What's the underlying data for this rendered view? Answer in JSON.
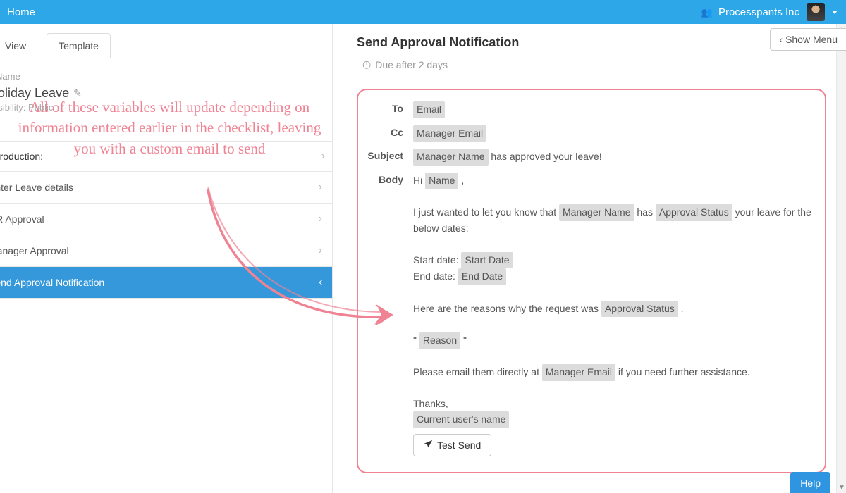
{
  "topbar": {
    "home": "Home",
    "org_name": "Processpants Inc"
  },
  "tabs": {
    "view": "View",
    "template": "Template",
    "active": "template"
  },
  "sidebar": {
    "name_label": "Name",
    "title": "Holiday Leave",
    "visibility": "Visibility: Public",
    "section_heading": "Introduction:",
    "items": [
      {
        "label": "Enter Leave details",
        "active": false
      },
      {
        "label": "HR Approval",
        "active": false
      },
      {
        "label": "Manager Approval",
        "active": false
      },
      {
        "label": "Send Approval Notification",
        "active": true
      }
    ]
  },
  "main": {
    "title": "Send Approval Notification",
    "due_text": "Due after 2 days",
    "show_menu": "Show Menu"
  },
  "email": {
    "labels": {
      "to": "To",
      "cc": "Cc",
      "subject": "Subject",
      "body": "Body"
    },
    "to_var": "Email",
    "cc_var": "Manager Email",
    "subject_var": "Manager Name",
    "subject_suffix": " has approved your leave!",
    "body": {
      "greet_prefix": "Hi ",
      "greet_var": "Name",
      "greet_suffix": " ,",
      "p1_a": "I just wanted to let you know that ",
      "p1_v1": "Manager Name",
      "p1_b": " has ",
      "p1_v2": "Approval Status",
      "p1_c": " your leave for the below dates:",
      "start_label": "Start date: ",
      "start_var": "Start Date",
      "end_label": "End date: ",
      "end_var": "End Date",
      "p2_a": "Here are the reasons why the request was ",
      "p2_v": "Approval Status",
      "p2_b": " .",
      "quote_open": "\" ",
      "reason_var": "Reason",
      "quote_close": " \"",
      "p3_a": "Please email them directly at ",
      "p3_v": "Manager Email",
      "p3_b": " if you need further assistance.",
      "thanks": "Thanks,",
      "sig_var": "Current user's name"
    },
    "test_send": "Test Send"
  },
  "help": "Help",
  "annotation": "All of these variables will update depending on information entered earlier in the checklist, leaving you with a custom email to send"
}
